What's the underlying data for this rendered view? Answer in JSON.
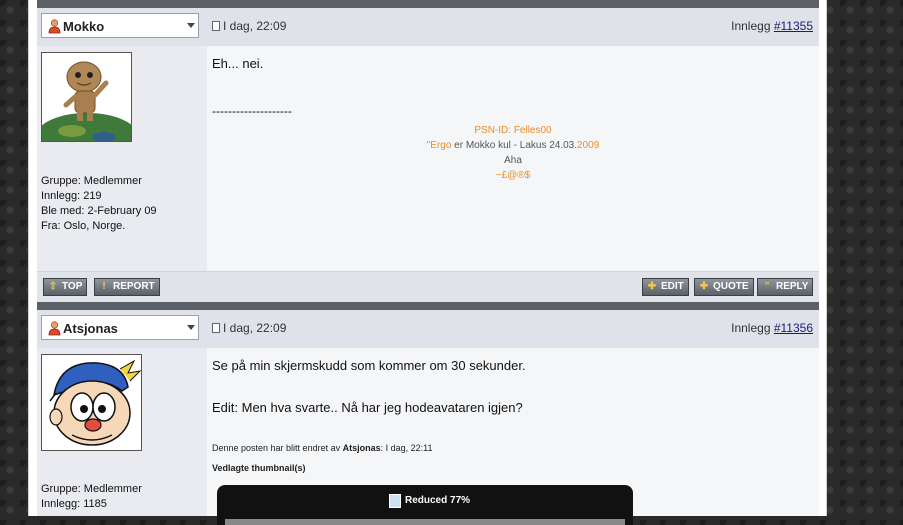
{
  "posts": [
    {
      "username": "Mokko",
      "date": "I dag, 22:09",
      "post_label": "Innlegg",
      "post_number": "#11355",
      "group": "Gruppe: Medlemmer",
      "posts_count": "Innlegg: 219",
      "joined": "Ble med: 2-February 09",
      "location": "Fra: Oslo, Norge.",
      "message_lines": [
        "Eh... nei.",
        "--------------------"
      ],
      "signature": {
        "line1": "PSN-ID: Felles00",
        "line2_prefix": "\"Ergo",
        "line2_mid": " er Mokko kul - Lakus 24.03.",
        "line2_year": "2009",
        "line3": "Aha",
        "line4": "~£@®$"
      },
      "buttons": {
        "top": "TOP",
        "report": "REPORT",
        "edit": "EDIT",
        "quote": "QUOTE",
        "reply": "REPLY"
      }
    },
    {
      "username": "Atsjonas",
      "date": "I dag, 22:09",
      "post_label": "Innlegg",
      "post_number": "#11356",
      "group": "Gruppe: Medlemmer",
      "posts_count": "Innlegg: 1185",
      "message_lines": [
        "Se på min skjermskudd som kommer om 30 sekunder.",
        "Edit: Men hva svarte.. Nå har jeg hodeavataren igjen?"
      ],
      "edit_note_prefix": "Denne posten har blitt endret av",
      "edit_note_author": "Atsjonas",
      "edit_note_suffix": ": I dag, 22:11",
      "attachments_title": "Vedlagte thumbnail(s)",
      "thumbnail_label": "Reduced 77%"
    }
  ]
}
